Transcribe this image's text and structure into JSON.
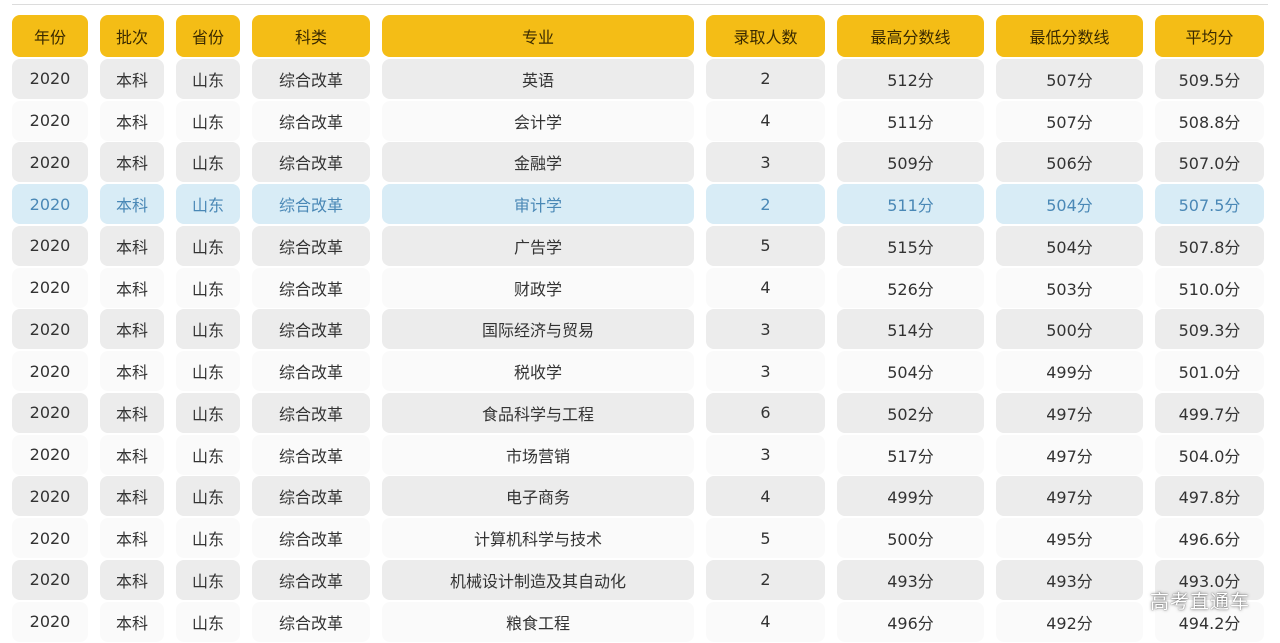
{
  "headers": [
    "年份",
    "批次",
    "省份",
    "科类",
    "专业",
    "录取人数",
    "最高分数线",
    "最低分数线",
    "平均分"
  ],
  "rows": [
    [
      "2020",
      "本科",
      "山东",
      "综合改革",
      "英语",
      "2",
      "512分",
      "507分",
      "509.5分"
    ],
    [
      "2020",
      "本科",
      "山东",
      "综合改革",
      "会计学",
      "4",
      "511分",
      "507分",
      "508.8分"
    ],
    [
      "2020",
      "本科",
      "山东",
      "综合改革",
      "金融学",
      "3",
      "509分",
      "506分",
      "507.0分"
    ],
    [
      "2020",
      "本科",
      "山东",
      "综合改革",
      "审计学",
      "2",
      "511分",
      "504分",
      "507.5分"
    ],
    [
      "2020",
      "本科",
      "山东",
      "综合改革",
      "广告学",
      "5",
      "515分",
      "504分",
      "507.8分"
    ],
    [
      "2020",
      "本科",
      "山东",
      "综合改革",
      "财政学",
      "4",
      "526分",
      "503分",
      "510.0分"
    ],
    [
      "2020",
      "本科",
      "山东",
      "综合改革",
      "国际经济与贸易",
      "3",
      "514分",
      "500分",
      "509.3分"
    ],
    [
      "2020",
      "本科",
      "山东",
      "综合改革",
      "税收学",
      "3",
      "504分",
      "499分",
      "501.0分"
    ],
    [
      "2020",
      "本科",
      "山东",
      "综合改革",
      "食品科学与工程",
      "6",
      "502分",
      "497分",
      "499.7分"
    ],
    [
      "2020",
      "本科",
      "山东",
      "综合改革",
      "市场营销",
      "3",
      "517分",
      "497分",
      "504.0分"
    ],
    [
      "2020",
      "本科",
      "山东",
      "综合改革",
      "电子商务",
      "4",
      "499分",
      "497分",
      "497.8分"
    ],
    [
      "2020",
      "本科",
      "山东",
      "综合改革",
      "计算机科学与技术",
      "5",
      "500分",
      "495分",
      "496.6分"
    ],
    [
      "2020",
      "本科",
      "山东",
      "综合改革",
      "机械设计制造及其自动化",
      "2",
      "493分",
      "493分",
      "493.0分"
    ],
    [
      "2020",
      "本科",
      "山东",
      "综合改革",
      "粮食工程",
      "4",
      "496分",
      "492分",
      "494.2分"
    ]
  ],
  "highlighted_row_index": 3,
  "watermark": "高考直通车",
  "colors": {
    "header_bg": "#f4bd16",
    "highlight_bg": "#d8ecf6",
    "highlight_text": "#4a88b6",
    "shaded_row_bg": "#ececec"
  }
}
